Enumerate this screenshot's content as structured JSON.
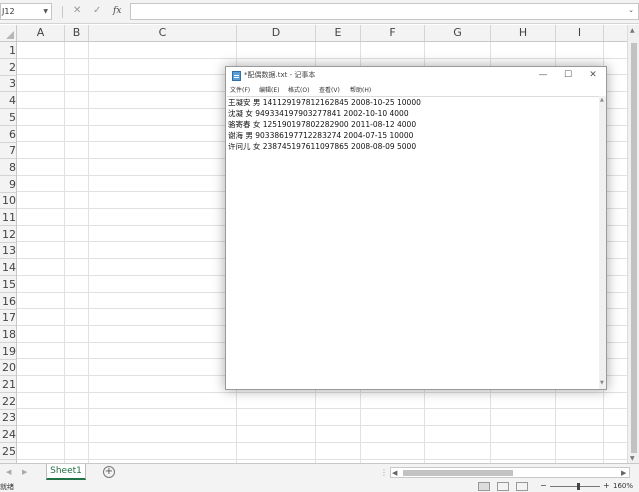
{
  "formula_bar": {
    "name_box": "J12",
    "cancel_icon": "✕",
    "confirm_icon": "✓",
    "fx_label": "fx",
    "formula_value": ""
  },
  "columns": [
    "A",
    "B",
    "C",
    "D",
    "E",
    "F",
    "G",
    "H",
    "I"
  ],
  "rows": [
    "1",
    "2",
    "3",
    "4",
    "5",
    "6",
    "7",
    "8",
    "9",
    "10",
    "11",
    "12",
    "13",
    "14",
    "15",
    "16",
    "17",
    "18",
    "19",
    "20",
    "21",
    "22",
    "23",
    "24",
    "25"
  ],
  "sheet_tabs": [
    {
      "label": "Sheet1",
      "active": true
    }
  ],
  "status_bar": {
    "status_text": "就绪",
    "zoom_level": "160%"
  },
  "notepad": {
    "title": "*配偶数据.txt - 记事本",
    "menu": [
      "文件(F)",
      "编辑(E)",
      "格式(O)",
      "查看(V)",
      "帮助(H)"
    ],
    "lines": [
      "王凝安 男 141129197812162845 2008-10-25 10000",
      "沈凝 女 949334197903277841 2002-10-10 4000",
      "骆寄春 女 125190197802282900 2011-08-12 4000",
      "谢海 男 903386197712283274 2004-07-15 10000",
      "许问儿 女 238745197611097865 2008-08-09 5000"
    ]
  }
}
